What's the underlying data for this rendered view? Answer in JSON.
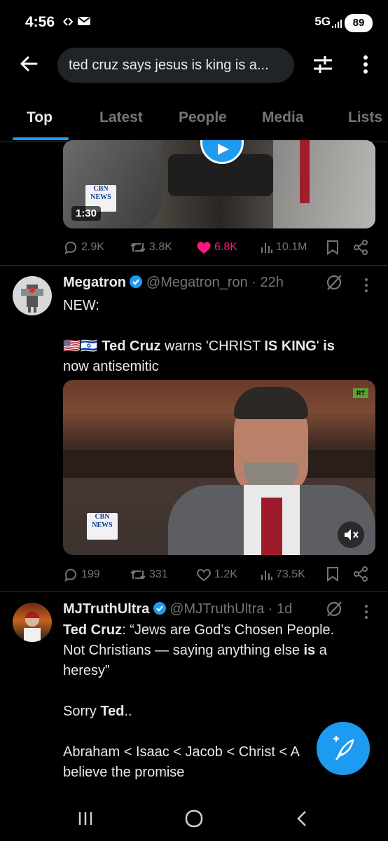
{
  "status": {
    "time": "4:56",
    "network": "5G",
    "battery": "89"
  },
  "search": {
    "query": "ted cruz says jesus is king is a..."
  },
  "tabs": [
    "Top",
    "Latest",
    "People",
    "Media",
    "Lists"
  ],
  "tweet0": {
    "media_badge": "CBN NEWS",
    "duration": "1:30",
    "replies": "2.9K",
    "retweets": "3.8K",
    "likes": "6.8K",
    "views": "10.1M"
  },
  "tweet1": {
    "name": "Megatron",
    "handle": "@Megatron_ron · 22h",
    "line1": "NEW:",
    "line2_flags": "🇺🇸🇮🇱",
    "line2_a": "Ted Cruz",
    "line2_b": " warns 'CHRIST ",
    "line2_c": "IS KING",
    "line2_d": "' ",
    "line2_e": "is",
    "line3": "now antisemitic",
    "media_badge": "CBN NEWS",
    "rt_badge": "RT",
    "replies": "199",
    "retweets": "331",
    "likes": "1.2K",
    "views": "73.5K"
  },
  "tweet2": {
    "name": "MJTruthUltra",
    "handle": "@MJTruthUltra · 1d",
    "p1_a": "Ted Cruz",
    "p1_b": ": “Jews are God’s Chosen People.",
    "p1_c": "Not Christians — saying anything else ",
    "p1_d": "is",
    "p1_e": " a",
    "p1_f": "heresy”",
    "p2_a": "Sorry ",
    "p2_b": "Ted",
    "p2_c": "..",
    "p3_a": "Abraham < Isaac < Jacob < Christ < A",
    "p3_b": "believe the promise"
  },
  "colors": {
    "accent": "#1d9bf0",
    "like": "#f91880",
    "bg": "#000000",
    "muted": "#71767b"
  }
}
